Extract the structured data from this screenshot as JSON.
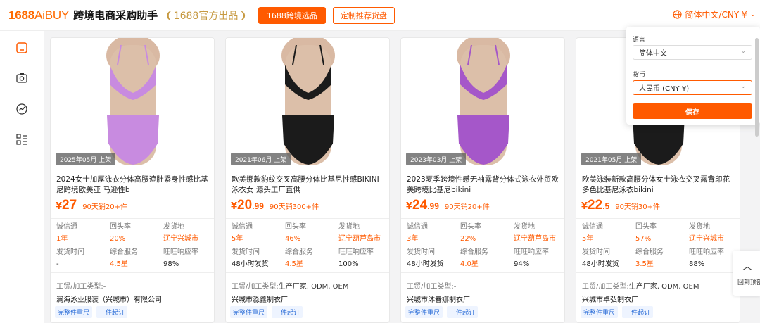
{
  "header": {
    "logo_main": "1688",
    "logo_sub": "AiBUY",
    "app_name": "跨境电商采购助手",
    "badge": "1688官方出品",
    "btn_primary": "1688跨境选品",
    "btn_outline": "定制推荐货盘",
    "lang_currency": "简体中文/CNY ¥"
  },
  "sidebar": {
    "icons": [
      "home-icon",
      "image-search-icon",
      "trend-icon",
      "list-icon"
    ]
  },
  "dropdown": {
    "language_label": "语言",
    "language_value": "简体中文",
    "currency_label": "货币",
    "currency_value": "人民币 (CNY ¥)",
    "save": "保存"
  },
  "labels": {
    "cheng_xin_tong": "诚信通",
    "hui_tou_lv": "回头率",
    "fa_huo_di": "发货地",
    "fa_huo_shi_jian": "发货时间",
    "zong_he_fu_wu": "综合服务",
    "wang_wang": "旺旺响应率",
    "factory_type_label": "工贸/加工类型:"
  },
  "products": [
    {
      "color": "#c88be0",
      "date": "2025年05月 上架",
      "title": "2024女士加厚泳衣分体高腰遮肚紧身性感比基尼跨境欧美亚 马逊性b",
      "currency": "¥",
      "price_int": "27",
      "price_dec": "",
      "sold": "90天销20+件",
      "cxt": "1年",
      "repurchase": "20%",
      "origin": "辽宁兴城市",
      "ship_time": "-",
      "service": "4.5星",
      "ww_rate": "98%",
      "factory_type": "-",
      "company": "澜海泳业服装（兴城市）有限公司",
      "tag1": "完整件重尺",
      "tag2": "一件起订"
    },
    {
      "color": "#1b1b1b",
      "date": "2021年06月 上架",
      "title": "欧美娜款豹纹交叉高腰分体比基尼性感BIKINI泳衣女 源头工厂直供",
      "currency": "¥",
      "price_int": "20",
      "price_dec": ".99",
      "sold": "90天销300+件",
      "cxt": "5年",
      "repurchase": "46%",
      "origin": "辽宁葫芦岛市",
      "ship_time": "48小时发货",
      "service": "4.5星",
      "ww_rate": "100%",
      "factory_type": "生产厂家, ODM, OEM",
      "company": "兴城市淼鑫制衣厂",
      "tag1": "完整件重尺",
      "tag2": "一件起订"
    },
    {
      "color": "#a557c9",
      "date": "2023年03月 上架",
      "title": "2023夏季跨境性感无袖露背分体式泳衣外贸欧美跨境比基尼bikini",
      "currency": "¥",
      "price_int": "24",
      "price_dec": ".99",
      "sold": "90天销20+件",
      "cxt": "3年",
      "repurchase": "22%",
      "origin": "辽宁葫芦岛市",
      "ship_time": "48小时发货",
      "service": "4.0星",
      "ww_rate": "94%",
      "factory_type": "-",
      "company": "兴城市沐春娜制衣厂",
      "tag1": "完整件重尺",
      "tag2": "一件起订"
    },
    {
      "color": "#1b1b1b",
      "date": "2021年05月 上架",
      "title": "欧美泳装新款高腰分体女士泳衣交叉露背印花多色比基尼泳衣bikini",
      "currency": "¥",
      "price_int": "22",
      "price_dec": ".5",
      "sold": "90天销30+件",
      "cxt": "5年",
      "repurchase": "57%",
      "origin": "辽宁兴城市",
      "ship_time": "48小时发货",
      "service": "3.5星",
      "ww_rate": "88%",
      "factory_type": "生产厂家, ODM, OEM",
      "company": "兴城市卓弘制衣厂",
      "tag1": "完整件重尺",
      "tag2": "一件起订"
    }
  ],
  "back_to_top": "回到顶部"
}
